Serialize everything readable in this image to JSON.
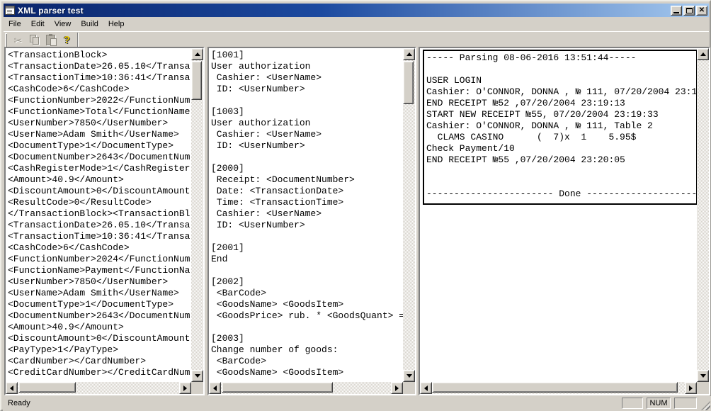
{
  "window": {
    "title": "XML parser test"
  },
  "menu": {
    "items": [
      "File",
      "Edit",
      "View",
      "Build",
      "Help"
    ]
  },
  "toolbar": {
    "cut_glyph": "✂",
    "help_glyph": "?",
    "icons": [
      "cut-icon",
      "copy-icon",
      "paste-icon",
      "help-icon"
    ]
  },
  "colors": {
    "titlebar_left": "#0a246a",
    "titlebar_right": "#a6caf0",
    "chrome": "#d4d0c8",
    "panel_bg": "#ffffff",
    "output_border": "#000000"
  },
  "panels": {
    "xml": {
      "lines": [
        "<TransactionBlock>",
        "<TransactionDate>26.05.10</Transa",
        "<TransactionTime>10:36:41</Transa",
        "<CashCode>6</CashCode>",
        "<FunctionNumber>2022</FunctionNum",
        "<FunctionName>Total</FunctionName",
        "<UserNumber>7850</UserNumber>",
        "<UserName>Adam Smith</UserName>",
        "<DocumentType>1</DocumentType>",
        "<DocumentNumber>2643</DocumentNum",
        "<CashRegisterMode>1</CashRegister",
        "<Amount>40.9</Amount>",
        "<DiscountAmount>0</DiscountAmount",
        "<ResultCode>0</ResultCode>",
        "</TransactionBlock><TransactionBl",
        "<TransactionDate>26.05.10</Transa",
        "<TransactionTime>10:36:41</Transa",
        "<CashCode>6</CashCode>",
        "<FunctionNumber>2024</FunctionNum",
        "<FunctionName>Payment</FunctionNa",
        "<UserNumber>7850</UserNumber>",
        "<UserName>Adam Smith</UserName>",
        "<DocumentType>1</DocumentType>",
        "<DocumentNumber>2643</DocumentNum",
        "<Amount>40.9</Amount>",
        "<DiscountAmount>0</DiscountAmount",
        "<PayType>1</PayType>",
        "<CardNumber></CardNumber>",
        "<CreditCardNumber></CreditCardNum"
      ]
    },
    "templates": {
      "lines": [
        "[1001]",
        "User authorization",
        " Cashier: <UserName>",
        " ID: <UserNumber>",
        "",
        "[1003]",
        "User authorization",
        " Cashier: <UserName>",
        " ID: <UserNumber>",
        "",
        "[2000]",
        " Receipt: <DocumentNumber>",
        " Date: <TransactionDate>",
        " Time: <TransactionTime>",
        " Cashier: <UserName>",
        " ID: <UserNumber>",
        "",
        "[2001]",
        "End",
        "",
        "[2002]",
        " <BarCode>",
        " <GoodsName> <GoodsItem>",
        " <GoodsPrice> rub. * <GoodsQuant> =",
        "",
        "[2003]",
        "Change number of goods:",
        " <BarCode>",
        " <GoodsName> <GoodsItem>"
      ]
    },
    "output": {
      "lines": [
        "----- Parsing 08-06-2016 13:51:44-----",
        "",
        "USER LOGIN",
        "Cashier: O'CONNOR, DONNA , № 111, 07/20/2004 23:1",
        "END RECEIPT №52 ,07/20/2004 23:19:13",
        "START NEW RECEIPT №55, 07/20/2004 23:19:33",
        "Cashier: O'CONNOR, DONNA , № 111, Table 2",
        "  CLAMS CASINO      (  7)x  1    5.95$",
        "Check Payment/10",
        "END RECEIPT №55 ,07/20/2004 23:20:05",
        "",
        "",
        "----------------------- Done ----------------------"
      ]
    }
  },
  "status": {
    "ready": "Ready",
    "num": "NUM"
  }
}
